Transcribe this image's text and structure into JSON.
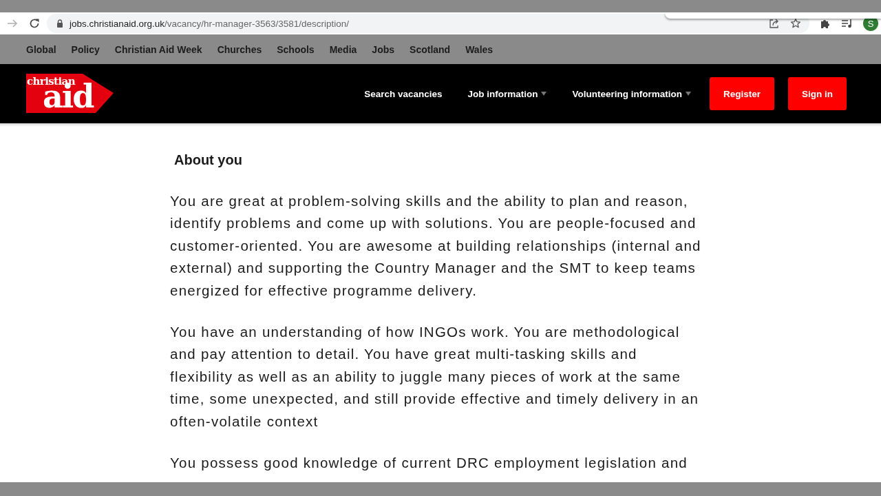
{
  "browser": {
    "forward_disabled": true,
    "url_host": "jobs.christianaid.org.uk",
    "url_path": "/vacancy/hr-manager-3563/3581/description/",
    "profile_initial": "S"
  },
  "site_links": [
    "Global",
    "Policy",
    "Christian Aid Week",
    "Churches",
    "Schools",
    "Media",
    "Jobs",
    "Scotland",
    "Wales"
  ],
  "header": {
    "logo": {
      "line_1": "christian",
      "line_2": "aid"
    },
    "nav": [
      {
        "label": "Search vacancies",
        "dropdown": false
      },
      {
        "label": "Job information",
        "dropdown": true
      },
      {
        "label": "Volunteering information",
        "dropdown": true
      }
    ],
    "buttons": [
      "Register",
      "Sign in"
    ]
  },
  "content": {
    "heading": "About you",
    "paragraphs": [
      "You are great at problem-solving skills and the ability to plan and reason, identify problems and come up with solutions. You are people-focused and customer-oriented. You are awesome at building relationships (internal and external) and supporting the Country Manager and the SMT to keep teams energized for effective programme delivery.",
      "You have an understanding of how INGOs work. You are methodological and pay attention to detail. You have great multi-tasking skills and flexibility as well as an ability to juggle many pieces of work at the same time, some unexpected, and still provide effective and timely delivery in an often-volatile context",
      "You possess good knowledge of current DRC employment legislation and"
    ]
  }
}
